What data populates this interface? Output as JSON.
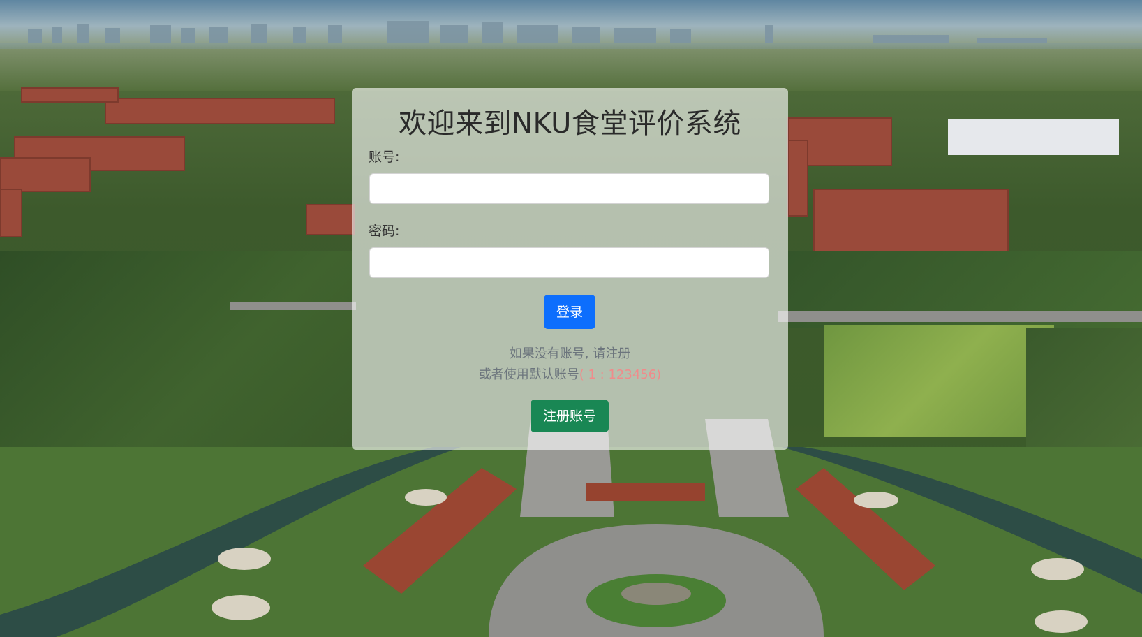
{
  "login": {
    "title": "欢迎来到NKU食堂评价系统",
    "account_label": "账号:",
    "account_value": "",
    "password_label": "密码:",
    "password_value": "",
    "login_button": "登录",
    "hint_line1": "如果没有账号, 请注册",
    "hint_line2_prefix": "或者使用默认账号",
    "hint_line2_account": "( 1 : 123456)",
    "register_button": "注册账号"
  },
  "colors": {
    "login_button": "#0d6efd",
    "register_button": "#198754",
    "hint_text": "#6c757d",
    "default_account_text": "#f08b8b"
  }
}
